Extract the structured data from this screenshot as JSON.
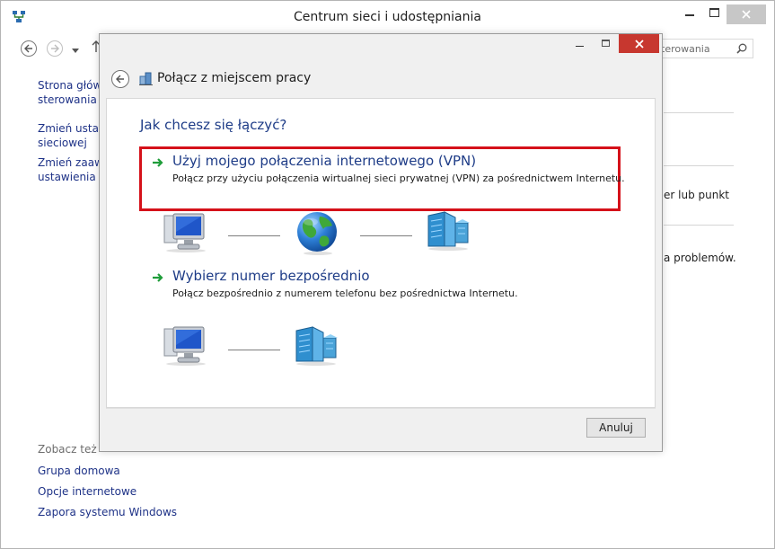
{
  "outer": {
    "title": "Centrum sieci i udostępniania",
    "search_text": "terowania",
    "left_links": [
      "Strona główn\nsterowania",
      "Zmień ustaw\nsieciowej",
      "Zmień zaawa\nustawienia ud"
    ],
    "see_also_label": "Zobacz też",
    "see_also": [
      "Grupa domowa",
      "Opcje internetowe",
      "Zapora systemu Windows"
    ],
    "right_fragments": [
      "er lub punkt",
      "a problemów."
    ]
  },
  "dialog": {
    "title": "Połącz z miejscem pracy",
    "question": "Jak chcesz się łączyć?",
    "options": [
      {
        "title": "Użyj mojego połączenia internetowego (VPN)",
        "desc": "Połącz przy użyciu połączenia wirtualnej sieci prywatnej (VPN) za pośrednictwem Internetu."
      },
      {
        "title": "Wybierz numer bezpośrednio",
        "desc": "Połącz bezpośrednio z numerem telefonu bez pośrednictwa Internetu."
      }
    ],
    "cancel_label": "Anuluj"
  },
  "icons": {
    "app": "network-icon",
    "arrow": "green-arrow-icon",
    "computer": "computer-icon",
    "globe": "globe-icon",
    "server": "server-icon"
  },
  "colors": {
    "highlight": "#d5111a",
    "link_blue": "#1e3c87",
    "close_red": "#c7372f"
  }
}
